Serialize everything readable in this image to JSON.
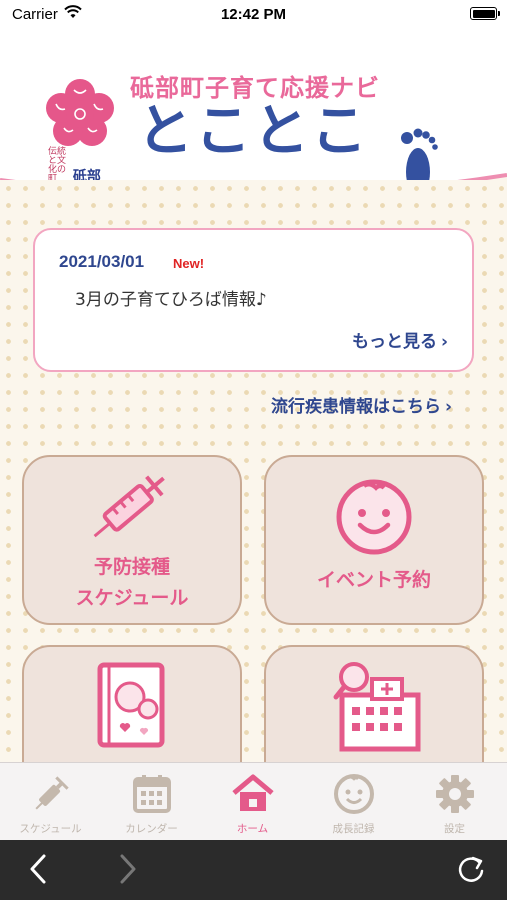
{
  "status_bar": {
    "carrier": "Carrier",
    "time": "12:42 PM"
  },
  "header": {
    "subtitle": "砥部町子育て応援ナビ",
    "title": "とことこ",
    "town_logo_small": "伝統と文化の町",
    "town_logo_big": "砥部"
  },
  "news": {
    "date": "2021/03/01",
    "badge": "New!",
    "text": "3月の子育てひろば情報♪",
    "more_label": "もっと見る"
  },
  "disease_link_label": "流行疾患情報はこちら",
  "menu": {
    "vaccine_line1": "予防接種",
    "vaccine_line2": "スケジュール",
    "event": "イベント予約"
  },
  "tabs": [
    {
      "label": "スケジュール",
      "icon": "syringe-icon"
    },
    {
      "label": "カレンダー",
      "icon": "calendar-icon"
    },
    {
      "label": "ホーム",
      "icon": "home-icon",
      "active": true
    },
    {
      "label": "成長記録",
      "icon": "face-icon"
    },
    {
      "label": "設定",
      "icon": "gear-icon"
    }
  ],
  "colors": {
    "brand_pink": "#e45a8a",
    "brand_navy": "#3451a0",
    "tile_bg": "#efe3dc",
    "toolbar_bg": "#2b2b2b"
  }
}
